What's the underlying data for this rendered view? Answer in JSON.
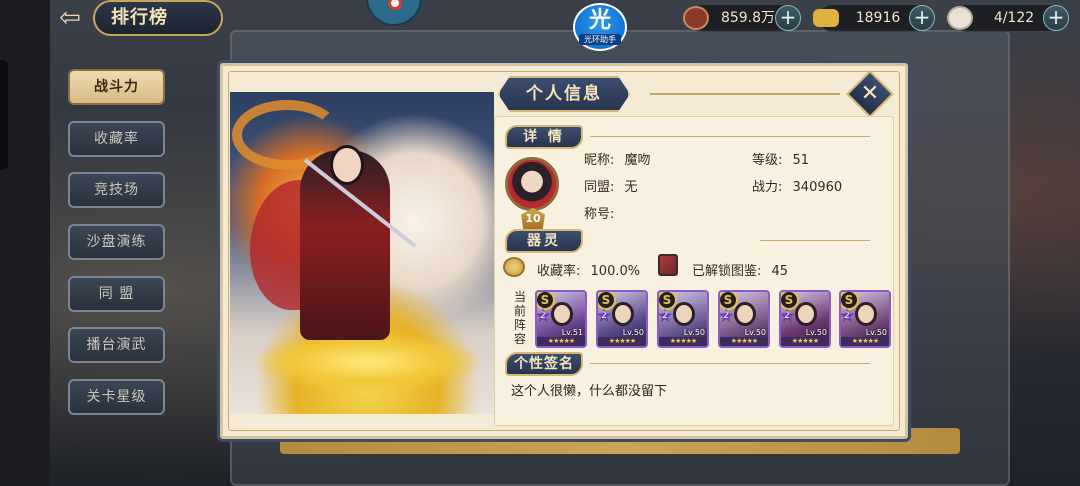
{
  "top_bar": {
    "back_icon": "back-arrow-icon",
    "title": "排行榜",
    "resources": [
      {
        "name": "copper-coin",
        "value": "859.8万",
        "icon_color": "#8a3a2a"
      },
      {
        "name": "gold-ingot",
        "value": "18916",
        "icon_color": "#e0b040"
      },
      {
        "name": "stamina",
        "value": "4/122",
        "icon_color": "#e8e2d4"
      }
    ]
  },
  "logo": {
    "char": "光",
    "sub": "光环助手"
  },
  "sidebar": {
    "items": [
      {
        "label": "战斗力",
        "active": true
      },
      {
        "label": "收藏率",
        "active": false
      },
      {
        "label": "竞技场",
        "active": false
      },
      {
        "label": "沙盘演练",
        "active": false
      },
      {
        "label": "同 盟",
        "active": false
      },
      {
        "label": "播台演武",
        "active": false
      },
      {
        "label": "关卡星级",
        "active": false
      }
    ]
  },
  "dialog": {
    "title": "个人信息",
    "close_icon": "close-x-icon",
    "details": {
      "section_label": "详 情",
      "level_badge": "10",
      "nickname_label": "昵称:",
      "nickname": "魔吻",
      "alliance_label": "同盟:",
      "alliance": "无",
      "title_label": "称号:",
      "title_value": "",
      "level_label": "等级:",
      "level": "51",
      "power_label": "战力:",
      "power": "340960"
    },
    "artifact": {
      "section_label": "器灵",
      "collection_label": "收藏率:",
      "collection_rate": "100.0%",
      "unlocked_label": "已解锁图鉴:",
      "unlocked_count": "45"
    },
    "lineup": {
      "label": "当前阵容",
      "cards": [
        {
          "level": "Lv.51",
          "star": "2",
          "bg": "#6e4a96"
        },
        {
          "level": "Lv.50",
          "star": "2",
          "bg": "#5a4b8a"
        },
        {
          "level": "Lv.50",
          "star": "2",
          "bg": "#6f5c9a"
        },
        {
          "level": "Lv.50",
          "star": "2",
          "bg": "#7a5a88"
        },
        {
          "level": "Lv.50",
          "star": "2",
          "bg": "#6b3a70"
        },
        {
          "level": "Lv.50",
          "star": "2",
          "bg": "#74497a"
        }
      ]
    },
    "signature": {
      "section_label": "个性签名",
      "text": "这个人很懒，什么都没留下"
    }
  }
}
